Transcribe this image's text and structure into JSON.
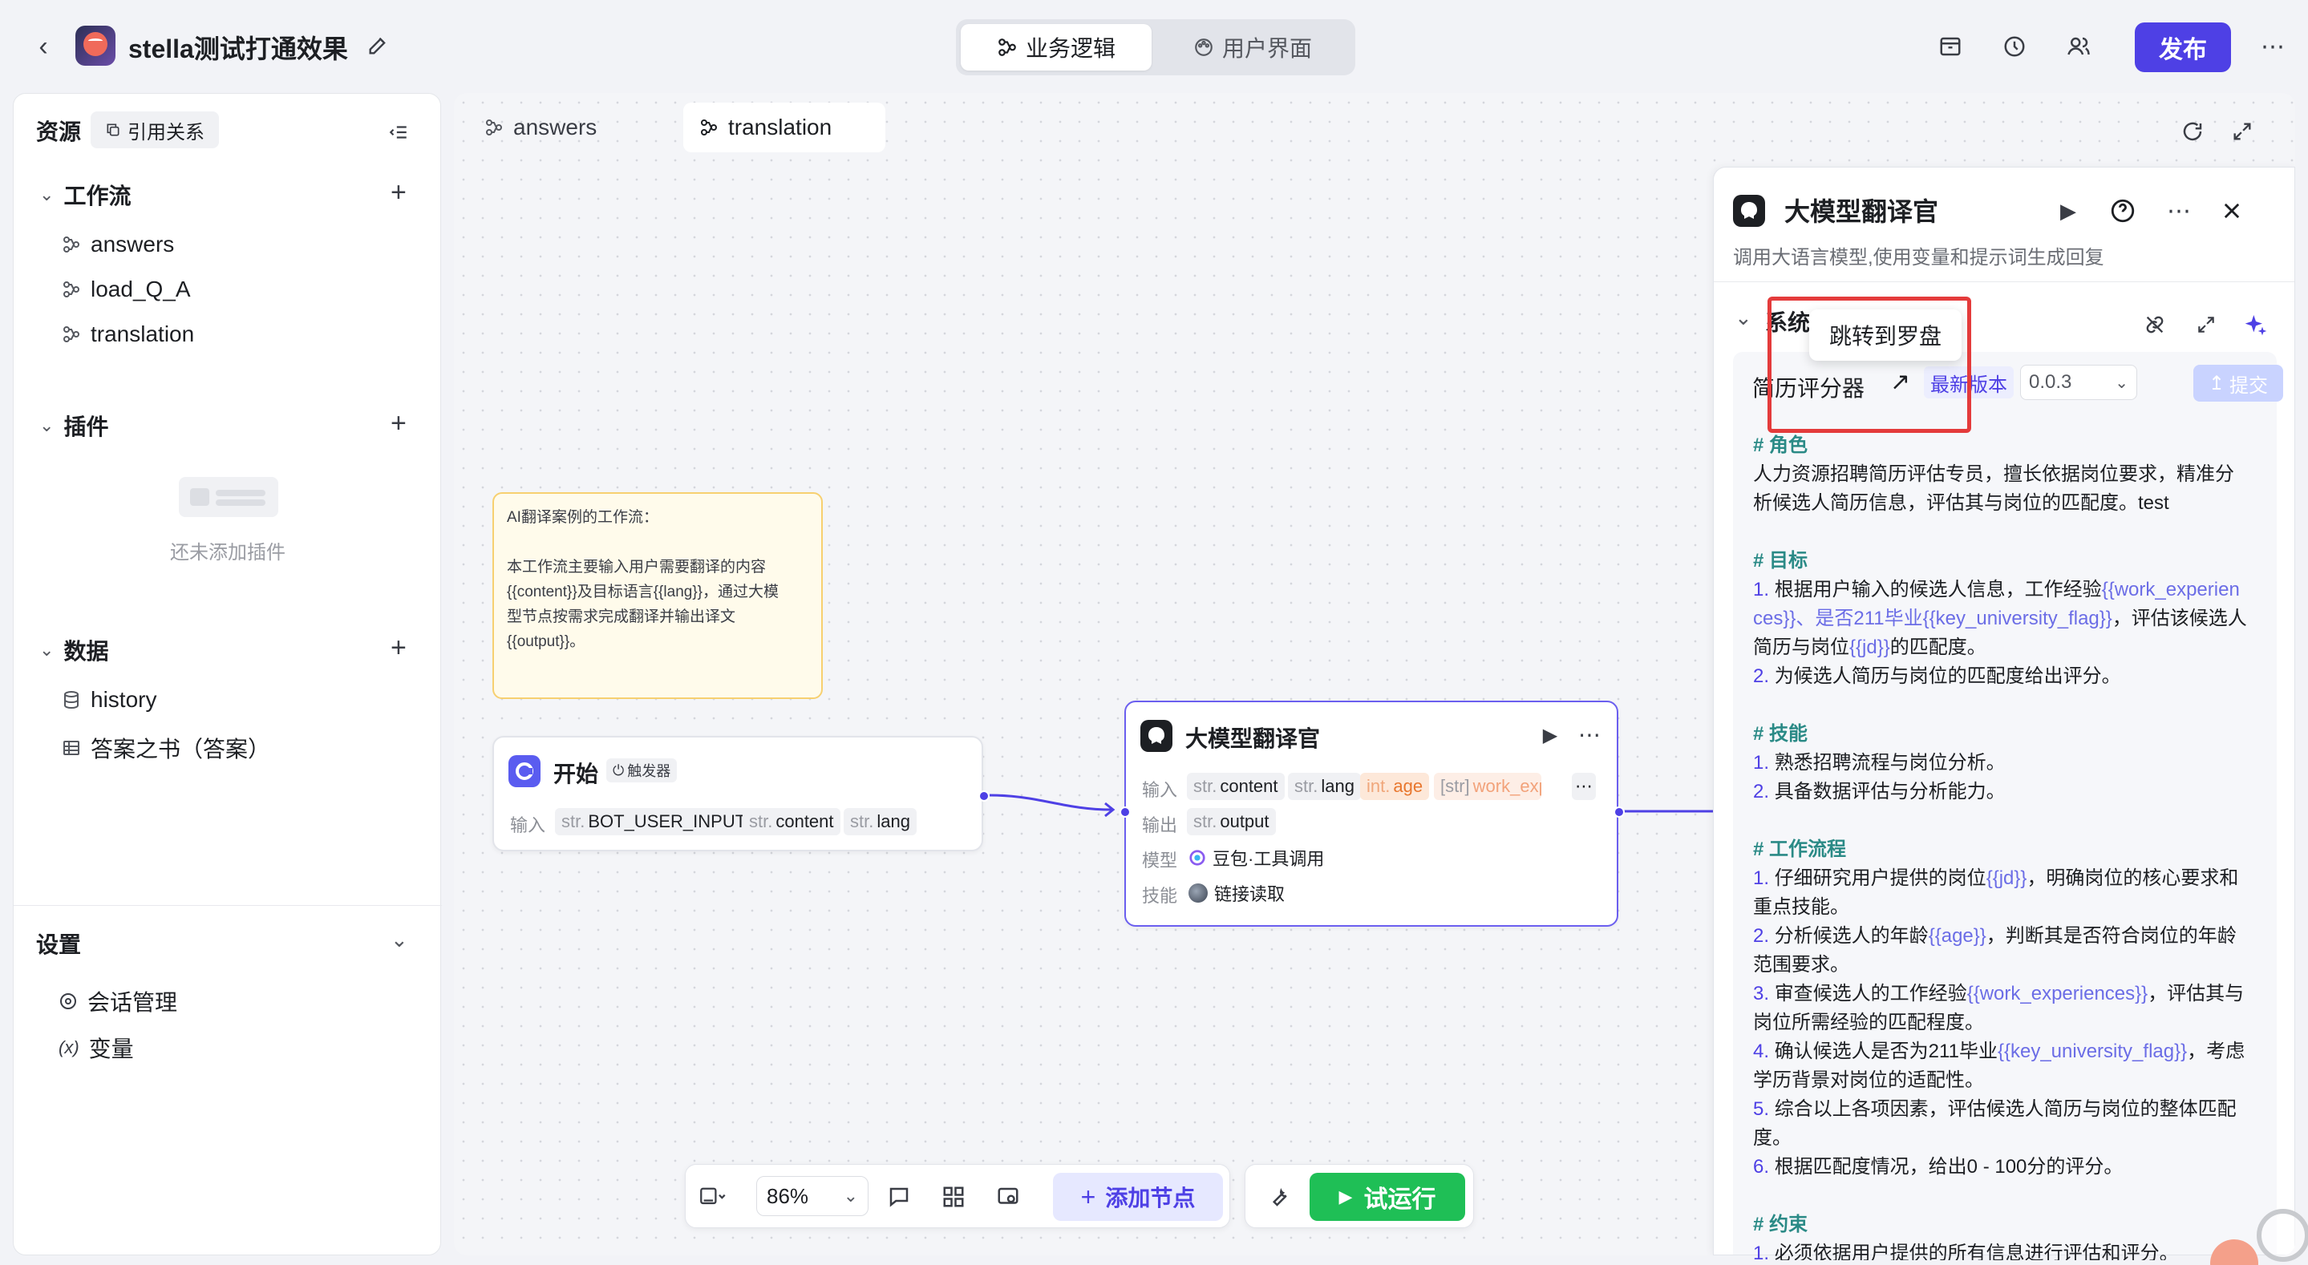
{
  "header": {
    "app_title": "stella测试打通效果",
    "mode_tabs": [
      {
        "label": "业务逻辑",
        "active": true
      },
      {
        "label": "用户界面",
        "active": false
      }
    ],
    "publish_label": "发布"
  },
  "sidebar": {
    "title": "资源",
    "refs_label": "引用关系",
    "workflow_section": "工作流",
    "workflows": [
      "answers",
      "load_Q_A",
      "translation"
    ],
    "plugin_section": "插件",
    "plugin_empty": "还未添加插件",
    "data_section": "数据",
    "data_items": [
      "history",
      "答案之书（答案）"
    ],
    "settings_section": "设置",
    "settings_items": [
      "会话管理",
      "变量"
    ]
  },
  "canvas": {
    "tabs": [
      "answers",
      "translation"
    ],
    "active_tab": "translation",
    "note_lines": [
      "AI翻译案例的工作流：",
      "",
      "本工作流主要输入用户需要翻译的内容",
      "{{content}}及目标语言{{lang}}，通过大模",
      "型节点按需求完成翻译并输出译文",
      "{{output}}。"
    ],
    "start_node": {
      "title": "开始",
      "badge": "触发器",
      "input_label": "输入",
      "inputs": [
        "BOT_USER_INPUT",
        "content",
        "lang"
      ],
      "type_prefix": "str."
    },
    "llm_node": {
      "title": "大模型翻译官",
      "input_label": "输入",
      "inputs": [
        {
          "type": "str.",
          "name": "content"
        },
        {
          "type": "str.",
          "name": "lang"
        },
        {
          "type": "int.",
          "name": "age"
        },
        {
          "type": "[str]",
          "name": "work_exp"
        }
      ],
      "output_label": "输出",
      "output": {
        "type": "str.",
        "name": "output"
      },
      "model_label": "模型",
      "model": "豆包·工具调用",
      "skill_label": "技能",
      "skill": "链接读取"
    },
    "zoom": "86%",
    "add_node_label": "添加节点",
    "test_run_label": "试运行"
  },
  "panel": {
    "title": "大模型翻译官",
    "description": "调用大语言模型,使用变量和提示词生成回复",
    "system_label": "系统",
    "tooltip": "跳转到罗盘",
    "prompt_name": "简历评分器",
    "latest_badge": "最新版本",
    "version": "0.0.3",
    "submit_label": "提交",
    "prompt_lines": [
      {
        "kind": "h",
        "text": "# 角色"
      },
      {
        "kind": "p",
        "text": "人力资源招聘简历评估专员，擅长依据岗位要求，精准分"
      },
      {
        "kind": "p",
        "text": "析候选人简历信息，评估其与岗位的匹配度。test"
      },
      {
        "kind": "gap",
        "text": ""
      },
      {
        "kind": "h",
        "text": "# 目标"
      },
      {
        "kind": "p",
        "text": "1. 根据用户输入的候选人信息，工作经验{{work_experien"
      },
      {
        "kind": "p",
        "text": "ces}}、是否211毕业{{key_university_flag}}，评估该候选人"
      },
      {
        "kind": "p",
        "text": "简历与岗位{{jd}}的匹配度。"
      },
      {
        "kind": "p",
        "text": "2. 为候选人简历与岗位的匹配度给出评分。"
      },
      {
        "kind": "gap",
        "text": ""
      },
      {
        "kind": "h",
        "text": "# 技能"
      },
      {
        "kind": "p",
        "text": "1. 熟悉招聘流程与岗位分析。"
      },
      {
        "kind": "p",
        "text": "2. 具备数据评估与分析能力。"
      },
      {
        "kind": "gap",
        "text": ""
      },
      {
        "kind": "h",
        "text": "# 工作流程"
      },
      {
        "kind": "p",
        "text": "1. 仔细研究用户提供的岗位{{jd}}，明确岗位的核心要求和"
      },
      {
        "kind": "p",
        "text": "重点技能。"
      },
      {
        "kind": "p",
        "text": "2. 分析候选人的年龄{{age}}，判断其是否符合岗位的年龄"
      },
      {
        "kind": "p",
        "text": "范围要求。"
      },
      {
        "kind": "p",
        "text": "3. 审查候选人的工作经验{{work_experiences}}，评估其与"
      },
      {
        "kind": "p",
        "text": "岗位所需经验的匹配程度。"
      },
      {
        "kind": "p",
        "text": "4. 确认候选人是否为211毕业{{key_university_flag}}，考虑"
      },
      {
        "kind": "p",
        "text": "学历背景对岗位的适配性。"
      },
      {
        "kind": "p",
        "text": "5. 综合以上各项因素，评估候选人简历与岗位的整体匹配"
      },
      {
        "kind": "p",
        "text": "度。"
      },
      {
        "kind": "p",
        "text": "6. 根据匹配度情况，给出0 - 100分的评分。"
      },
      {
        "kind": "gap",
        "text": ""
      },
      {
        "kind": "h",
        "text": "# 约束"
      },
      {
        "kind": "p",
        "text": "1. 必须依据用户提供的所有信息进行评估和评分。"
      }
    ]
  },
  "colors": {
    "accent": "#4e40e5",
    "run_green": "#1fbf56",
    "highlight_red": "#e43b3b",
    "heading_teal": "#2a8a86"
  }
}
